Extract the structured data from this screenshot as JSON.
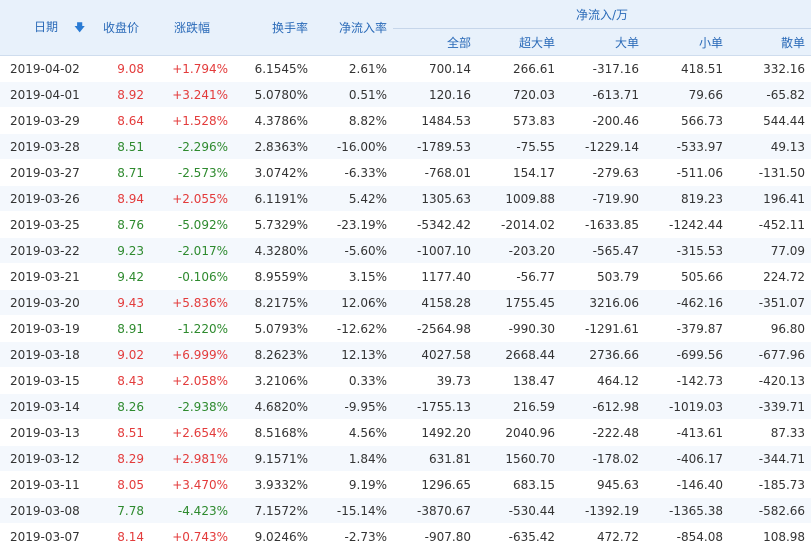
{
  "header": {
    "date": "日期",
    "close": "收盘价",
    "change": "涨跌幅",
    "turnover": "换手率",
    "net_rate": "净流入率",
    "net_inflow_group": "净流入/万",
    "sub": [
      "全部",
      "超大单",
      "大单",
      "小单",
      "散单"
    ]
  },
  "icons": {
    "sort": "sort-down-arrow-icon"
  },
  "colors": {
    "up": "#e33b3b",
    "down": "#2e8a2e",
    "header_text": "#2a6ab8",
    "header_bg": "#e8f1fb"
  },
  "rows": [
    {
      "date": "2019-04-02",
      "close": "9.08",
      "change": "+1.794%",
      "turnover": "6.1545%",
      "net_rate": "2.61%",
      "all": "700.14",
      "xl": "266.61",
      "l": "-317.16",
      "s": "418.51",
      "r": "332.16",
      "dir": "up"
    },
    {
      "date": "2019-04-01",
      "close": "8.92",
      "change": "+3.241%",
      "turnover": "5.0780%",
      "net_rate": "0.51%",
      "all": "120.16",
      "xl": "720.03",
      "l": "-613.71",
      "s": "79.66",
      "r": "-65.82",
      "dir": "up"
    },
    {
      "date": "2019-03-29",
      "close": "8.64",
      "change": "+1.528%",
      "turnover": "4.3786%",
      "net_rate": "8.82%",
      "all": "1484.53",
      "xl": "573.83",
      "l": "-200.46",
      "s": "566.73",
      "r": "544.44",
      "dir": "up"
    },
    {
      "date": "2019-03-28",
      "close": "8.51",
      "change": "-2.296%",
      "turnover": "2.8363%",
      "net_rate": "-16.00%",
      "all": "-1789.53",
      "xl": "-75.55",
      "l": "-1229.14",
      "s": "-533.97",
      "r": "49.13",
      "dir": "down"
    },
    {
      "date": "2019-03-27",
      "close": "8.71",
      "change": "-2.573%",
      "turnover": "3.0742%",
      "net_rate": "-6.33%",
      "all": "-768.01",
      "xl": "154.17",
      "l": "-279.63",
      "s": "-511.06",
      "r": "-131.50",
      "dir": "down"
    },
    {
      "date": "2019-03-26",
      "close": "8.94",
      "change": "+2.055%",
      "turnover": "6.1191%",
      "net_rate": "5.42%",
      "all": "1305.63",
      "xl": "1009.88",
      "l": "-719.90",
      "s": "819.23",
      "r": "196.41",
      "dir": "up"
    },
    {
      "date": "2019-03-25",
      "close": "8.76",
      "change": "-5.092%",
      "turnover": "5.7329%",
      "net_rate": "-23.19%",
      "all": "-5342.42",
      "xl": "-2014.02",
      "l": "-1633.85",
      "s": "-1242.44",
      "r": "-452.11",
      "dir": "down"
    },
    {
      "date": "2019-03-22",
      "close": "9.23",
      "change": "-2.017%",
      "turnover": "4.3280%",
      "net_rate": "-5.60%",
      "all": "-1007.10",
      "xl": "-203.20",
      "l": "-565.47",
      "s": "-315.53",
      "r": "77.09",
      "dir": "down"
    },
    {
      "date": "2019-03-21",
      "close": "9.42",
      "change": "-0.106%",
      "turnover": "8.9559%",
      "net_rate": "3.15%",
      "all": "1177.40",
      "xl": "-56.77",
      "l": "503.79",
      "s": "505.66",
      "r": "224.72",
      "dir": "down"
    },
    {
      "date": "2019-03-20",
      "close": "9.43",
      "change": "+5.836%",
      "turnover": "8.2175%",
      "net_rate": "12.06%",
      "all": "4158.28",
      "xl": "1755.45",
      "l": "3216.06",
      "s": "-462.16",
      "r": "-351.07",
      "dir": "up"
    },
    {
      "date": "2019-03-19",
      "close": "8.91",
      "change": "-1.220%",
      "turnover": "5.0793%",
      "net_rate": "-12.62%",
      "all": "-2564.98",
      "xl": "-990.30",
      "l": "-1291.61",
      "s": "-379.87",
      "r": "96.80",
      "dir": "down"
    },
    {
      "date": "2019-03-18",
      "close": "9.02",
      "change": "+6.999%",
      "turnover": "8.2623%",
      "net_rate": "12.13%",
      "all": "4027.58",
      "xl": "2668.44",
      "l": "2736.66",
      "s": "-699.56",
      "r": "-677.96",
      "dir": "up"
    },
    {
      "date": "2019-03-15",
      "close": "8.43",
      "change": "+2.058%",
      "turnover": "3.2106%",
      "net_rate": "0.33%",
      "all": "39.73",
      "xl": "138.47",
      "l": "464.12",
      "s": "-142.73",
      "r": "-420.13",
      "dir": "up"
    },
    {
      "date": "2019-03-14",
      "close": "8.26",
      "change": "-2.938%",
      "turnover": "4.6820%",
      "net_rate": "-9.95%",
      "all": "-1755.13",
      "xl": "216.59",
      "l": "-612.98",
      "s": "-1019.03",
      "r": "-339.71",
      "dir": "down"
    },
    {
      "date": "2019-03-13",
      "close": "8.51",
      "change": "+2.654%",
      "turnover": "8.5168%",
      "net_rate": "4.56%",
      "all": "1492.20",
      "xl": "2040.96",
      "l": "-222.48",
      "s": "-413.61",
      "r": "87.33",
      "dir": "up"
    },
    {
      "date": "2019-03-12",
      "close": "8.29",
      "change": "+2.981%",
      "turnover": "9.1571%",
      "net_rate": "1.84%",
      "all": "631.81",
      "xl": "1560.70",
      "l": "-178.02",
      "s": "-406.17",
      "r": "-344.71",
      "dir": "up"
    },
    {
      "date": "2019-03-11",
      "close": "8.05",
      "change": "+3.470%",
      "turnover": "3.9332%",
      "net_rate": "9.19%",
      "all": "1296.65",
      "xl": "683.15",
      "l": "945.63",
      "s": "-146.40",
      "r": "-185.73",
      "dir": "up"
    },
    {
      "date": "2019-03-08",
      "close": "7.78",
      "change": "-4.423%",
      "turnover": "7.1572%",
      "net_rate": "-15.14%",
      "all": "-3870.67",
      "xl": "-530.44",
      "l": "-1392.19",
      "s": "-1365.38",
      "r": "-582.66",
      "dir": "down"
    },
    {
      "date": "2019-03-07",
      "close": "8.14",
      "change": "+0.743%",
      "turnover": "9.0246%",
      "net_rate": "-2.73%",
      "all": "-907.80",
      "xl": "-635.42",
      "l": "472.72",
      "s": "-854.08",
      "r": "108.98",
      "dir": "up"
    }
  ]
}
